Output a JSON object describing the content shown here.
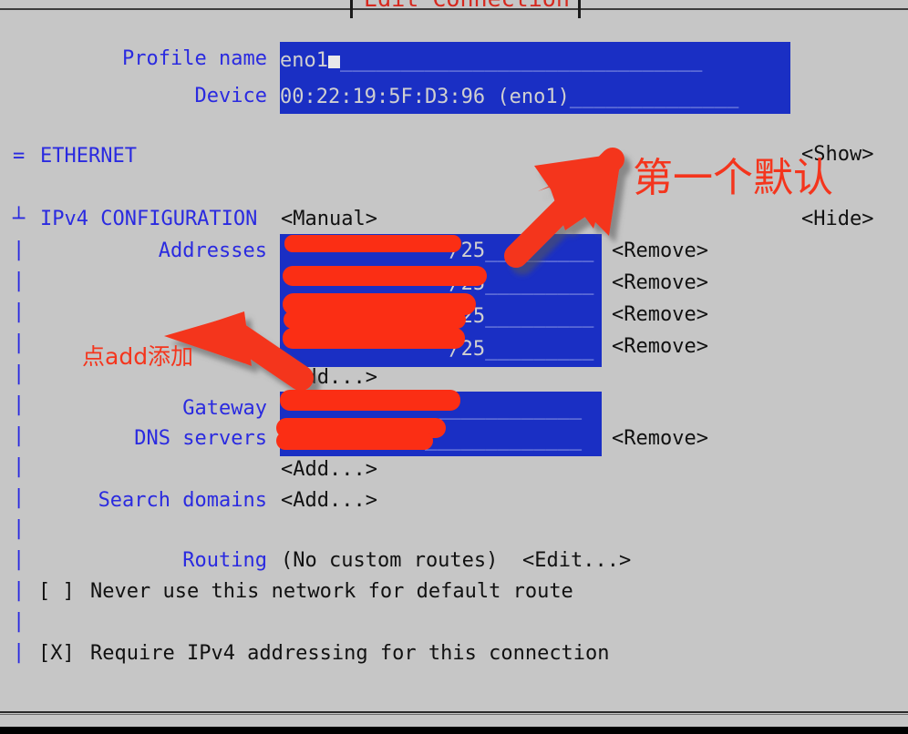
{
  "window": {
    "title": "Edit Connection"
  },
  "form": {
    "profile_name": {
      "label": "Profile name",
      "value": "eno1",
      "filler": "______________________________"
    },
    "device": {
      "label": "Device",
      "value": "00:22:19:5F:D3:96 (eno1)",
      "filler": "______________"
    }
  },
  "sections": {
    "ethernet": {
      "gutter": "=",
      "title": "ETHERNET",
      "action": "<Show>"
    },
    "ipv4": {
      "gutter": "┴",
      "title": "IPv4 CONFIGURATION",
      "mode": "<Manual>",
      "action": "<Hide>"
    }
  },
  "ipv4": {
    "addresses_label": "Addresses",
    "addresses": [
      {
        "value": "              /25",
        "filler": "_________",
        "remove": "<Remove>"
      },
      {
        "value": "              /25",
        "filler": "_________",
        "remove": "<Remove>"
      },
      {
        "value": "              /25",
        "filler": "_________",
        "remove": "<Remove>"
      },
      {
        "value": "              /25",
        "filler": "_________",
        "remove": "<Remove>"
      }
    ],
    "addresses_add": "<Add...>",
    "gateway_label": "Gateway",
    "gateway_value": "            ",
    "gateway_filler": "_____________",
    "dns_label": "DNS servers",
    "dns_value": "            ",
    "dns_filler": "_____________",
    "dns_remove": "<Remove>",
    "dns_add": "<Add...>",
    "search_domains_label": "Search domains",
    "search_domains_add": "<Add...>",
    "routing_label": "Routing",
    "routing_value": "(No custom routes)",
    "routing_edit": "<Edit...>",
    "never_default_checkbox": "[ ]",
    "never_default_label": "Never use this network for default route",
    "require_ipv4_checkbox": "[X]",
    "require_ipv4_label": "Require IPv4 addressing for this connection"
  },
  "annotations": {
    "first_default": "第一个默认",
    "click_add": "点add添加",
    "arrow_color": "#f4351d"
  },
  "colors": {
    "background": "#c6c6c6",
    "field_blue": "#1a2fc4",
    "label_blue": "#2a2ae0",
    "annotation_red": "#f4351d",
    "title_red": "#d6281e",
    "text_black": "#111111"
  }
}
